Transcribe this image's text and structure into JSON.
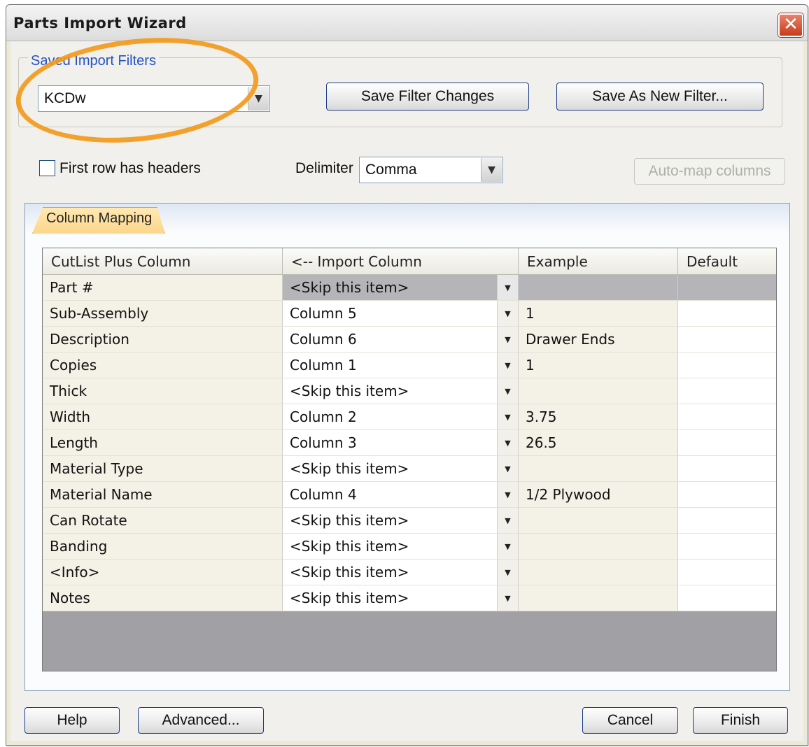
{
  "window": {
    "title": "Parts Import Wizard",
    "close_symbol": "✕"
  },
  "filters": {
    "legend": "Saved Import Filters",
    "selected": "KCDw",
    "save_changes_label": "Save Filter Changes",
    "save_new_label": "Save As New Filter..."
  },
  "options": {
    "first_row_headers_label": "First row has headers",
    "first_row_headers_checked": false,
    "delimiter_label": "Delimiter",
    "delimiter_value": "Comma",
    "auto_map_label": "Auto-map columns"
  },
  "tabs": [
    {
      "label": "Column Mapping",
      "active": true
    }
  ],
  "table": {
    "headers": [
      "CutList Plus Column",
      "<-- Import Column",
      "Example",
      "Default"
    ],
    "rows": [
      {
        "field": "Part #",
        "import": "<Skip this item>",
        "example": "",
        "default": "",
        "selected": true
      },
      {
        "field": "Sub-Assembly",
        "import": "Column 5",
        "example": "1",
        "default": ""
      },
      {
        "field": "Description",
        "import": "Column 6",
        "example": "Drawer Ends",
        "default": ""
      },
      {
        "field": "Copies",
        "import": "Column 1",
        "example": "1",
        "default": ""
      },
      {
        "field": "Thick",
        "import": "<Skip this item>",
        "example": "",
        "default": ""
      },
      {
        "field": "Width",
        "import": "Column 2",
        "example": "3.75",
        "default": ""
      },
      {
        "field": "Length",
        "import": "Column 3",
        "example": "26.5",
        "default": ""
      },
      {
        "field": "Material Type",
        "import": "<Skip this item>",
        "example": "",
        "default": ""
      },
      {
        "field": "Material Name",
        "import": "Column 4",
        "example": "1/2 Plywood",
        "default": ""
      },
      {
        "field": "Can Rotate",
        "import": "<Skip this item>",
        "example": "",
        "default": ""
      },
      {
        "field": "Banding",
        "import": "<Skip this item>",
        "example": "",
        "default": ""
      },
      {
        "field": "<Info>",
        "import": "<Skip this item>",
        "example": "",
        "default": ""
      },
      {
        "field": "Notes",
        "import": "<Skip this item>",
        "example": "",
        "default": ""
      }
    ]
  },
  "footer": {
    "help_label": "Help",
    "advanced_label": "Advanced...",
    "cancel_label": "Cancel",
    "finish_label": "Finish"
  },
  "colors": {
    "highlight": "#f39a1c",
    "legend": "#2453c4",
    "tab": "#fcd68b"
  }
}
